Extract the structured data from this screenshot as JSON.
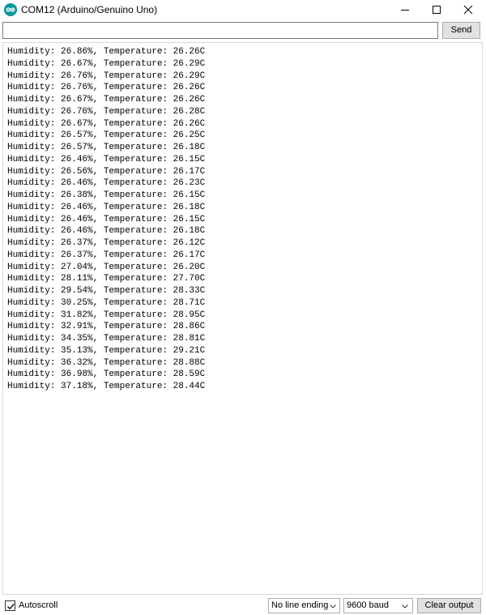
{
  "window": {
    "title": "COM12 (Arduino/Genuino Uno)",
    "icon": "arduino-logo-icon"
  },
  "input": {
    "value": "",
    "placeholder": "",
    "send_label": "Send"
  },
  "output": {
    "lines": [
      "Humidity: 26.86%, Temperature: 26.26C",
      "Humidity: 26.67%, Temperature: 26.29C",
      "Humidity: 26.76%, Temperature: 26.29C",
      "Humidity: 26.76%, Temperature: 26.26C",
      "Humidity: 26.67%, Temperature: 26.26C",
      "Humidity: 26.76%, Temperature: 26.28C",
      "Humidity: 26.67%, Temperature: 26.26C",
      "Humidity: 26.57%, Temperature: 26.25C",
      "Humidity: 26.57%, Temperature: 26.18C",
      "Humidity: 26.46%, Temperature: 26.15C",
      "Humidity: 26.56%, Temperature: 26.17C",
      "Humidity: 26.46%, Temperature: 26.23C",
      "Humidity: 26.38%, Temperature: 26.15C",
      "Humidity: 26.46%, Temperature: 26.18C",
      "Humidity: 26.46%, Temperature: 26.15C",
      "Humidity: 26.46%, Temperature: 26.18C",
      "Humidity: 26.37%, Temperature: 26.12C",
      "Humidity: 26.37%, Temperature: 26.17C",
      "Humidity: 27.04%, Temperature: 26.20C",
      "Humidity: 28.11%, Temperature: 27.70C",
      "Humidity: 29.54%, Temperature: 28.33C",
      "Humidity: 30.25%, Temperature: 28.71C",
      "Humidity: 31.82%, Temperature: 28.95C",
      "Humidity: 32.91%, Temperature: 28.86C",
      "Humidity: 34.35%, Temperature: 28.81C",
      "Humidity: 35.13%, Temperature: 29.21C",
      "Humidity: 36.32%, Temperature: 28.88C",
      "Humidity: 36.98%, Temperature: 28.59C",
      "Humidity: 37.18%, Temperature: 28.44C"
    ]
  },
  "footer": {
    "autoscroll_label": "Autoscroll",
    "autoscroll_checked": true,
    "line_ending": "No line ending",
    "baud_rate": "9600 baud",
    "clear_label": "Clear output"
  },
  "colors": {
    "arduino_teal": "#00979c",
    "button_face": "#e1e1e1",
    "border": "#adadad"
  }
}
